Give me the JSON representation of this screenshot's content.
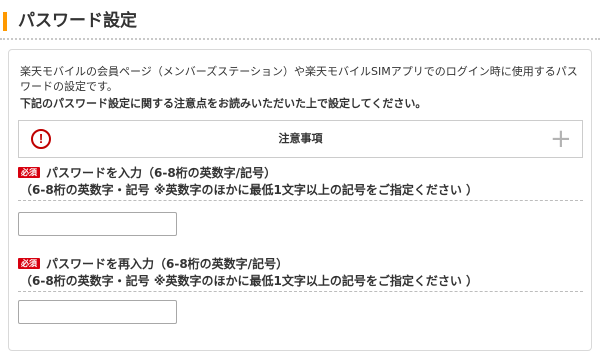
{
  "header": {
    "title": "パスワード設定"
  },
  "intro": {
    "text": "楽天モバイルの会員ページ（メンバーズステーション）や楽天モバイルSIMアプリでのログイン時に使用するパスワードの設定です。",
    "notice_text": "下記のパスワード設定に関する注意点をお読みいただいた上で設定してください。"
  },
  "notice": {
    "icon": "!",
    "title": "注意事項",
    "expand_icon": "+"
  },
  "fields": [
    {
      "badge": "必須",
      "label": "パスワードを入力（6-8桁の英数字/記号）",
      "sublabel": "（6-8桁の英数字・記号 ※英数字のほかに最低1文字以上の記号をご指定ください ）",
      "value": "",
      "placeholder": ""
    },
    {
      "badge": "必須",
      "label": "パスワードを再入力（6-8桁の英数字/記号）",
      "sublabel": "（6-8桁の英数字・記号 ※英数字のほかに最低1文字以上の記号をご指定ください ）",
      "value": "",
      "placeholder": ""
    }
  ],
  "colors": {
    "accent": "#ff9900",
    "required": "#d7000f",
    "alert": "#bf0000"
  }
}
